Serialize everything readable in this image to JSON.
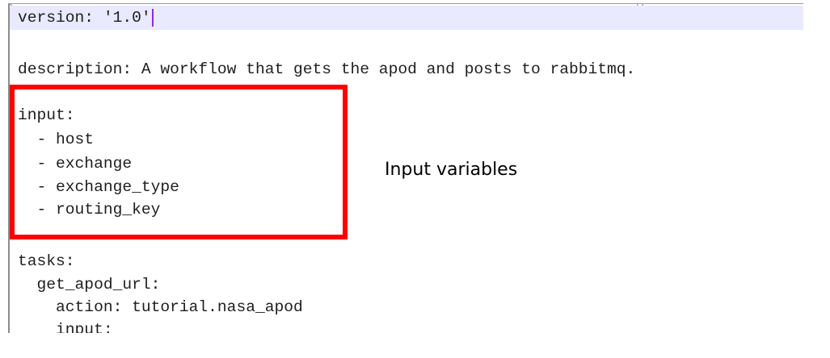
{
  "editor": {
    "lines": [
      "version: '1.0'",
      "",
      "description: A workflow that gets the apod and posts to rabbitmq.",
      "",
      "input:",
      "  - host",
      "  - exchange",
      "  - exchange_type",
      "  - routing_key",
      "",
      "tasks:",
      "  get_apod_url:",
      "    action: tutorial.nasa_apod",
      "    input:"
    ]
  },
  "annotation": {
    "text": "Input variables",
    "box_color": "#ff0000"
  },
  "colors": {
    "current_line_bg": "#e9e9ff",
    "caret": "#8a2be2",
    "text": "#1e1e1e"
  }
}
